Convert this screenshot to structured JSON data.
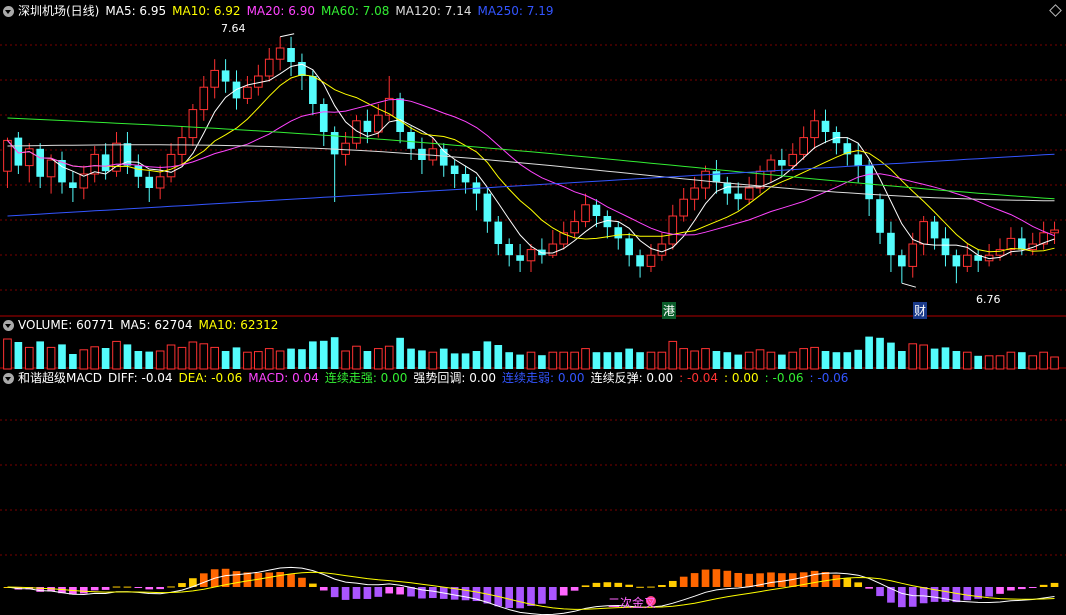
{
  "main_header": {
    "title": "深圳机场(日线)",
    "items": [
      {
        "label": "MA5: 6.95",
        "color": "#ffffff"
      },
      {
        "label": "MA10: 6.92",
        "color": "#ffff00"
      },
      {
        "label": "MA20: 6.90",
        "color": "#ff44ff"
      },
      {
        "label": "MA60: 7.08",
        "color": "#33ee33"
      },
      {
        "label": "MA120: 7.14",
        "color": "#dddddd"
      },
      {
        "label": "MA250: 7.19",
        "color": "#3355ff"
      }
    ]
  },
  "volume_header": {
    "items": [
      {
        "label": "VOLUME: 60771",
        "color": "#ffffff"
      },
      {
        "label": "MA5: 62704",
        "color": "#ffffff"
      },
      {
        "label": "MA10: 62312",
        "color": "#ffff00"
      }
    ]
  },
  "macd_header": {
    "items": [
      {
        "label": "和谐超级MACD",
        "color": "#ffffff"
      },
      {
        "label": "DIFF: -0.04",
        "color": "#ffffff"
      },
      {
        "label": "DEA: -0.06",
        "color": "#ffff00"
      },
      {
        "label": "MACD: 0.04",
        "color": "#ff44ff"
      },
      {
        "label": "连续走强: 0.00",
        "color": "#33ee33"
      },
      {
        "label": "强势回调: 0.00",
        "color": "#ffffff"
      },
      {
        "label": "连续走弱: 0.00",
        "color": "#3355ff"
      },
      {
        "label": "连续反弹: 0.00",
        "color": "#ffffff"
      },
      {
        "label": ": -0.04",
        "color": "#ff3333"
      },
      {
        "label": ": 0.00",
        "color": "#ffff00"
      },
      {
        "label": ": -0.06",
        "color": "#33ee33"
      },
      {
        "label": ": -0.06",
        "color": "#3355ff"
      }
    ]
  },
  "annotations": {
    "high_label": "7.64",
    "low_label": "6.76",
    "tag_gang": "港",
    "tag_cai": "财",
    "macd_signal": "二次金叉"
  },
  "colors": {
    "up": "#ff3232",
    "down": "#54fcfc",
    "grid": "#7a0000",
    "border": "#b00000",
    "ma5": "#ffffff",
    "ma10": "#ffff00",
    "ma20": "#ff44ff",
    "ma60": "#33ee33",
    "ma120": "#dddddd",
    "ma250": "#3355ff"
  },
  "chart_data": {
    "type": "candlestick",
    "security": "深圳机场",
    "period": "日线",
    "price_range": [
      6.7,
      7.7
    ],
    "candles": [
      [
        7.16,
        7.27,
        7.1,
        7.28
      ],
      [
        7.28,
        7.18,
        7.15,
        7.3
      ],
      [
        7.18,
        7.24,
        7.12,
        7.26
      ],
      [
        7.24,
        7.14,
        7.1,
        7.26
      ],
      [
        7.14,
        7.2,
        7.08,
        7.22
      ],
      [
        7.2,
        7.12,
        7.08,
        7.23
      ],
      [
        7.12,
        7.1,
        7.05,
        7.16
      ],
      [
        7.1,
        7.15,
        7.06,
        7.18
      ],
      [
        7.15,
        7.22,
        7.12,
        7.25
      ],
      [
        7.22,
        7.16,
        7.13,
        7.26
      ],
      [
        7.16,
        7.26,
        7.14,
        7.3
      ],
      [
        7.26,
        7.18,
        7.15,
        7.3
      ],
      [
        7.18,
        7.14,
        7.1,
        7.22
      ],
      [
        7.14,
        7.1,
        7.05,
        7.16
      ],
      [
        7.1,
        7.14,
        7.06,
        7.18
      ],
      [
        7.14,
        7.22,
        7.12,
        7.26
      ],
      [
        7.22,
        7.28,
        7.18,
        7.32
      ],
      [
        7.28,
        7.38,
        7.25,
        7.4
      ],
      [
        7.38,
        7.46,
        7.34,
        7.5
      ],
      [
        7.46,
        7.52,
        7.42,
        7.56
      ],
      [
        7.52,
        7.48,
        7.44,
        7.56
      ],
      [
        7.48,
        7.42,
        7.38,
        7.52
      ],
      [
        7.42,
        7.46,
        7.4,
        7.5
      ],
      [
        7.46,
        7.5,
        7.43,
        7.54
      ],
      [
        7.5,
        7.56,
        7.48,
        7.6
      ],
      [
        7.56,
        7.6,
        7.52,
        7.64
      ],
      [
        7.6,
        7.55,
        7.5,
        7.64
      ],
      [
        7.55,
        7.5,
        7.45,
        7.58
      ],
      [
        7.5,
        7.4,
        7.36,
        7.52
      ],
      [
        7.4,
        7.3,
        7.25,
        7.42
      ],
      [
        7.3,
        7.22,
        7.05,
        7.32
      ],
      [
        7.22,
        7.26,
        7.18,
        7.3
      ],
      [
        7.26,
        7.34,
        7.24,
        7.36
      ],
      [
        7.34,
        7.3,
        7.26,
        7.38
      ],
      [
        7.3,
        7.36,
        7.28,
        7.4
      ],
      [
        7.36,
        7.42,
        7.34,
        7.5
      ],
      [
        7.42,
        7.3,
        7.26,
        7.44
      ],
      [
        7.3,
        7.24,
        7.2,
        7.32
      ],
      [
        7.24,
        7.2,
        7.15,
        7.28
      ],
      [
        7.2,
        7.24,
        7.18,
        7.28
      ],
      [
        7.24,
        7.18,
        7.14,
        7.26
      ],
      [
        7.18,
        7.15,
        7.1,
        7.2
      ],
      [
        7.15,
        7.12,
        7.08,
        7.18
      ],
      [
        7.12,
        7.08,
        7.02,
        7.14
      ],
      [
        7.08,
        6.98,
        6.94,
        7.1
      ],
      [
        6.98,
        6.9,
        6.86,
        7.0
      ],
      [
        6.9,
        6.86,
        6.82,
        6.92
      ],
      [
        6.86,
        6.84,
        6.8,
        6.9
      ],
      [
        6.84,
        6.88,
        6.8,
        6.9
      ],
      [
        6.88,
        6.86,
        6.83,
        6.92
      ],
      [
        6.86,
        6.9,
        6.85,
        6.95
      ],
      [
        6.9,
        6.94,
        6.88,
        6.98
      ],
      [
        6.94,
        6.98,
        6.92,
        7.02
      ],
      [
        6.98,
        7.04,
        6.96,
        7.08
      ],
      [
        7.04,
        7.0,
        6.96,
        7.06
      ],
      [
        7.0,
        6.96,
        6.92,
        7.02
      ],
      [
        6.96,
        6.92,
        6.88,
        6.98
      ],
      [
        6.92,
        6.86,
        6.82,
        6.94
      ],
      [
        6.86,
        6.82,
        6.78,
        6.88
      ],
      [
        6.82,
        6.86,
        6.8,
        6.9
      ],
      [
        6.86,
        6.9,
        6.84,
        6.94
      ],
      [
        6.9,
        7.0,
        6.88,
        7.04
      ],
      [
        7.0,
        7.06,
        6.98,
        7.1
      ],
      [
        7.06,
        7.1,
        7.02,
        7.14
      ],
      [
        7.1,
        7.16,
        7.06,
        7.18
      ],
      [
        7.16,
        7.12,
        7.08,
        7.2
      ],
      [
        7.12,
        7.08,
        7.04,
        7.14
      ],
      [
        7.08,
        7.06,
        7.02,
        7.12
      ],
      [
        7.06,
        7.1,
        7.04,
        7.14
      ],
      [
        7.1,
        7.16,
        7.08,
        7.18
      ],
      [
        7.16,
        7.2,
        7.12,
        7.22
      ],
      [
        7.2,
        7.18,
        7.14,
        7.24
      ],
      [
        7.18,
        7.22,
        7.16,
        7.26
      ],
      [
        7.22,
        7.28,
        7.2,
        7.32
      ],
      [
        7.28,
        7.34,
        7.24,
        7.38
      ],
      [
        7.34,
        7.3,
        7.26,
        7.38
      ],
      [
        7.3,
        7.26,
        7.22,
        7.32
      ],
      [
        7.26,
        7.22,
        7.18,
        7.28
      ],
      [
        7.22,
        7.18,
        7.12,
        7.26
      ],
      [
        7.18,
        7.06,
        7.0,
        7.2
      ],
      [
        7.06,
        6.94,
        6.9,
        7.08
      ],
      [
        6.94,
        6.86,
        6.8,
        6.98
      ],
      [
        6.86,
        6.82,
        6.76,
        6.88
      ],
      [
        6.82,
        6.9,
        6.78,
        6.94
      ],
      [
        6.9,
        6.98,
        6.86,
        7.0
      ],
      [
        6.98,
        6.92,
        6.88,
        7.0
      ],
      [
        6.92,
        6.86,
        6.82,
        6.96
      ],
      [
        6.86,
        6.82,
        6.76,
        6.88
      ],
      [
        6.82,
        6.86,
        6.8,
        6.9
      ],
      [
        6.86,
        6.84,
        6.8,
        6.88
      ],
      [
        6.84,
        6.86,
        6.82,
        6.9
      ],
      [
        6.86,
        6.88,
        6.84,
        6.92
      ],
      [
        6.88,
        6.92,
        6.86,
        6.96
      ],
      [
        6.92,
        6.88,
        6.86,
        6.96
      ],
      [
        6.88,
        6.9,
        6.86,
        6.94
      ],
      [
        6.9,
        6.94,
        6.88,
        6.98
      ],
      [
        6.94,
        6.95,
        6.9,
        6.98
      ]
    ]
  }
}
